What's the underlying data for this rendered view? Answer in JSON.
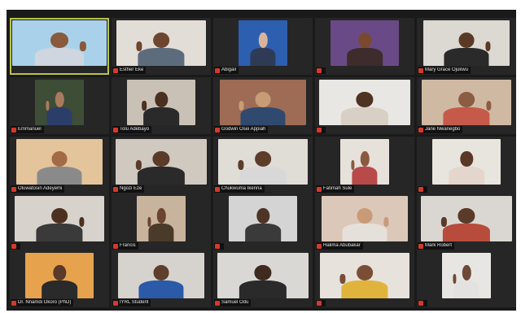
{
  "meeting": {
    "participants": [
      {
        "name": "",
        "muted": false,
        "active_speaker": true,
        "bg": "#a9d2ea",
        "skin": "#8a5a3c",
        "shirt": "#cfd6df",
        "hand": "right"
      },
      {
        "name": "Esther Eke",
        "muted": true,
        "bg": "#e2ddd6",
        "skin": "#6e4630",
        "shirt": "#5d6c7c",
        "hand": "left"
      },
      {
        "name": "Abigail",
        "muted": true,
        "bg": "#2d5fb0",
        "skin": "#d9b49c",
        "shirt": "#2f3b55",
        "hand": "none"
      },
      {
        "name": "",
        "muted": true,
        "bg": "#6a4a86",
        "skin": "#7a4a30",
        "shirt": "#3e2b2b",
        "hand": "none"
      },
      {
        "name": "Mary Grace Ojukwu",
        "muted": true,
        "bg": "#dcd8d2",
        "skin": "#5a3a26",
        "shirt": "#2a2a2a",
        "hand": "right"
      },
      {
        "name": "Emmanuel",
        "muted": true,
        "bg": "#3d4d36",
        "skin": "#a97a5e",
        "shirt": "#2b3e6a",
        "hand": "left"
      },
      {
        "name": "Tolu Adebayo",
        "muted": true,
        "bg": "#c9c1b6",
        "skin": "#4a3020",
        "shirt": "#2a2a2a",
        "hand": "left"
      },
      {
        "name": "Godwin Osei Appiah",
        "muted": true,
        "bg": "#9e6b54",
        "skin": "#c79c76",
        "shirt": "#2f4a6e",
        "hand": "left"
      },
      {
        "name": "",
        "muted": true,
        "bg": "#e9e7e3",
        "skin": "#4e3222",
        "shirt": "#d8d0c4",
        "hand": "none"
      },
      {
        "name": "Jane Nwanegbo",
        "muted": true,
        "bg": "#d0b9a3",
        "skin": "#8b5e44",
        "shirt": "#c65a4a",
        "hand": "right"
      },
      {
        "name": "Oluwatosin Adeyemi",
        "muted": true,
        "bg": "#e4c49a",
        "skin": "#a26a45",
        "shirt": "#8a8a8a",
        "hand": "none"
      },
      {
        "name": "Ngozi Eze",
        "muted": true,
        "bg": "#cfc9c0",
        "skin": "#5a3a28",
        "shirt": "#2a2a2a",
        "hand": "left"
      },
      {
        "name": "Chukwuma Ikenna",
        "muted": true,
        "bg": "#e0dcd6",
        "skin": "#5e3c2a",
        "shirt": "#d8d8d8",
        "hand": "left"
      },
      {
        "name": "Fatimah Sule",
        "muted": true,
        "bg": "#e6e1da",
        "skin": "#8a5a3e",
        "shirt": "#b84a4a",
        "hand": "left"
      },
      {
        "name": "",
        "muted": true,
        "bg": "#e8e4de",
        "skin": "#5a3826",
        "shirt": "#e4d6cc",
        "hand": "none"
      },
      {
        "name": "",
        "muted": true,
        "bg": "#d7d3cc",
        "skin": "#4c3020",
        "shirt": "#3a3a3a",
        "hand": "right"
      },
      {
        "name": "Francis",
        "muted": true,
        "bg": "#c8b49c",
        "skin": "#6a4430",
        "shirt": "#4a3a2a",
        "hand": "left"
      },
      {
        "name": "",
        "muted": true,
        "bg": "#d4d4d4",
        "skin": "#4e3424",
        "shirt": "#3a3a3a",
        "hand": "none"
      },
      {
        "name": "Halima Abubakar",
        "muted": true,
        "bg": "#dcc8b8",
        "skin": "#c89a78",
        "shirt": "#e6e0da",
        "hand": "right"
      },
      {
        "name": "Mark Robert",
        "muted": true,
        "bg": "#dad7d2",
        "skin": "#5a3a28",
        "shirt": "#b74c3c",
        "hand": "left"
      },
      {
        "name": "Dr. Nnamdi Okoro (PhD)",
        "muted": true,
        "bg": "#e7a24e",
        "skin": "#5a3a28",
        "shirt": "#2a2a2a",
        "hand": "none"
      },
      {
        "name": "IYRL Student",
        "muted": true,
        "bg": "#d6d3ce",
        "skin": "#5e3e2c",
        "shirt": "#2a5aa8",
        "hand": "none"
      },
      {
        "name": "Samuel Odu",
        "muted": true,
        "bg": "#d9d8d4",
        "skin": "#3e2a1e",
        "shirt": "#2a2a2a",
        "hand": "none"
      },
      {
        "name": "",
        "muted": true,
        "bg": "#e7e2dc",
        "skin": "#7a4e36",
        "shirt": "#e0b43c",
        "hand": "left"
      },
      {
        "name": "",
        "muted": true,
        "bg": "#e8e6e2",
        "skin": "#6e4a36",
        "shirt": "#e4e2de",
        "hand": "left"
      }
    ]
  }
}
